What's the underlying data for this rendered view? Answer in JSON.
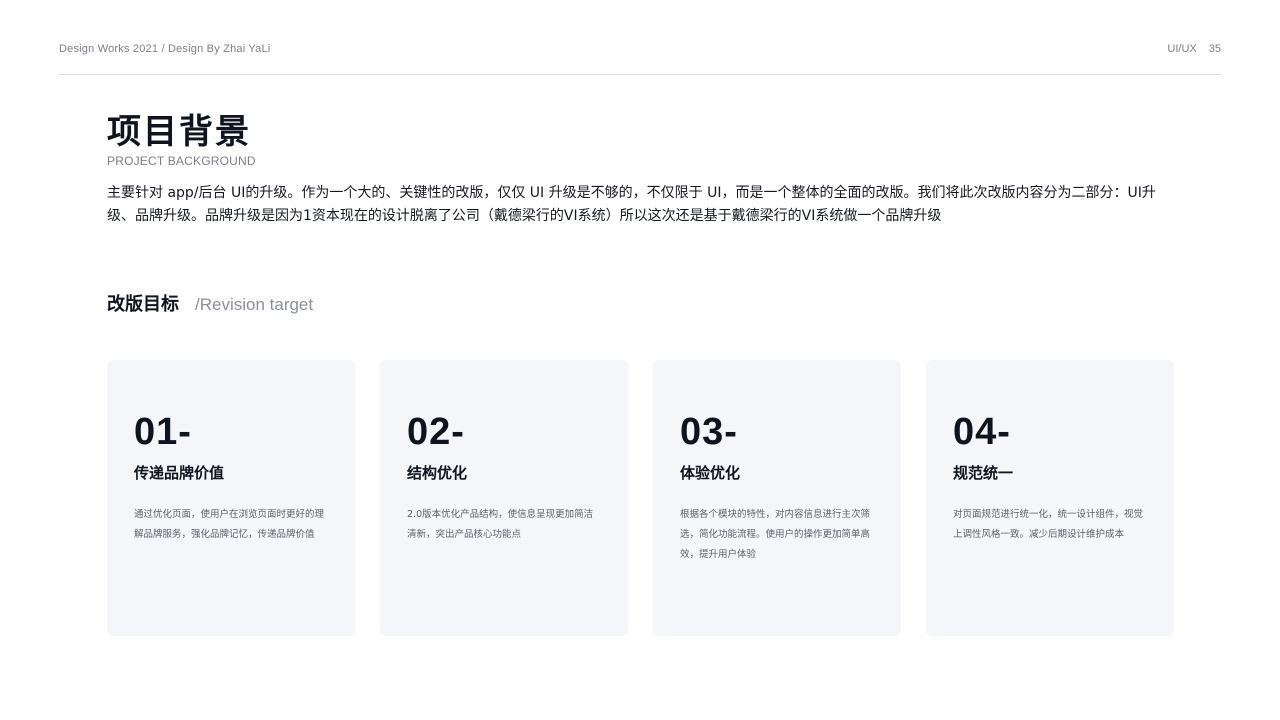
{
  "header": {
    "left": "Design Works 2021 / Design By Zhai YaLi",
    "category": "UI/UX",
    "page_number": "35"
  },
  "section": {
    "title": "项目背景",
    "subtitle": "PROJECT BACKGROUND",
    "intro": "主要针对 app/后台 UI的升级。作为一个大的、关键性的改版，仅仅 UI 升级是不够的，不仅限于 UI，而是一个整体的全面的改版。我们将此次改版内容分为二部分：UI升级、品牌升级。品牌升级是因为1资本现在的设计脱离了公司（戴德梁行的VI系统）所以这次还是基于戴德梁行的VI系统做一个品牌升级"
  },
  "target": {
    "title_cn": "改版目标",
    "title_en": "/Revision target"
  },
  "cards": [
    {
      "num": "01-",
      "title": "传递品牌价值",
      "desc": "通过优化页面，使用户在浏览页面时更好的理解品牌服务，强化品牌记忆，传递品牌价值"
    },
    {
      "num": "02-",
      "title": "结构优化",
      "desc": "2.0版本优化产品结构，使信息呈现更加简洁清新，突出产品核心功能点"
    },
    {
      "num": "03-",
      "title": "体验优化",
      "desc": "根据各个模块的特性，对内容信息进行主次筛选，简化功能流程。使用户的操作更加简单高效，提升用户体验"
    },
    {
      "num": "04-",
      "title": "规范统一",
      "desc": "对页面规范进行统一化，统一设计组件，视觉上调性风格一致。减少后期设计维护成本"
    }
  ]
}
